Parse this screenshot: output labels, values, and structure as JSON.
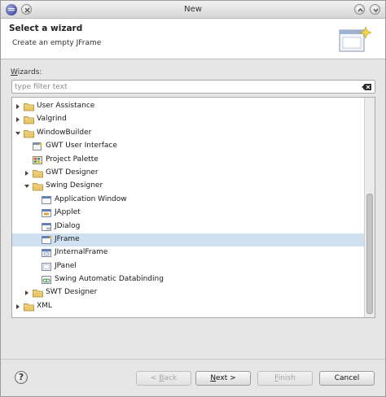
{
  "window": {
    "title": "New"
  },
  "header": {
    "title": "Select a wizard",
    "description": "Create an empty JFrame"
  },
  "wizards": {
    "label": "Wizards:",
    "filter_placeholder": "type filter text",
    "filter_value": ""
  },
  "tree": {
    "rows": [
      {
        "label": "User Assistance",
        "indent": 0,
        "state": "collapsed",
        "icon": "folder-icon",
        "selected": false
      },
      {
        "label": "Valgrind",
        "indent": 0,
        "state": "collapsed",
        "icon": "folder-icon",
        "selected": false
      },
      {
        "label": "WindowBuilder",
        "indent": 0,
        "state": "expanded",
        "icon": "folder-icon",
        "selected": false
      },
      {
        "label": "GWT User Interface",
        "indent": 1,
        "state": "leaf",
        "icon": "gwt-ui-icon",
        "selected": false
      },
      {
        "label": "Project Palette",
        "indent": 1,
        "state": "leaf",
        "icon": "palette-icon",
        "selected": false
      },
      {
        "label": "GWT Designer",
        "indent": 1,
        "state": "collapsed",
        "icon": "folder-icon",
        "selected": false
      },
      {
        "label": "Swing Designer",
        "indent": 1,
        "state": "expanded",
        "icon": "folder-icon",
        "selected": false
      },
      {
        "label": "Application Window",
        "indent": 2,
        "state": "leaf",
        "icon": "window-icon",
        "selected": false
      },
      {
        "label": "JApplet",
        "indent": 2,
        "state": "leaf",
        "icon": "applet-icon",
        "selected": false
      },
      {
        "label": "JDialog",
        "indent": 2,
        "state": "leaf",
        "icon": "dialog-icon",
        "selected": false
      },
      {
        "label": "JFrame",
        "indent": 2,
        "state": "leaf",
        "icon": "frame-icon",
        "selected": true
      },
      {
        "label": "JInternalFrame",
        "indent": 2,
        "state": "leaf",
        "icon": "internal-frame-icon",
        "selected": false
      },
      {
        "label": "JPanel",
        "indent": 2,
        "state": "leaf",
        "icon": "panel-icon",
        "selected": false
      },
      {
        "label": "Swing Automatic Databinding",
        "indent": 2,
        "state": "leaf",
        "icon": "databinding-icon",
        "selected": false
      },
      {
        "label": "SWT Designer",
        "indent": 1,
        "state": "collapsed",
        "icon": "folder-icon",
        "selected": false
      },
      {
        "label": "XML",
        "indent": 0,
        "state": "collapsed",
        "icon": "folder-icon",
        "selected": false
      }
    ]
  },
  "buttons": {
    "help_glyph": "?",
    "back_pre": "< ",
    "back_mn": "B",
    "back_rest": "ack",
    "next_mn": "N",
    "next_rest": "ext >",
    "finish_mn": "F",
    "finish_rest": "inish",
    "cancel": "Cancel"
  },
  "colors": {
    "selection": "#cfe0f1",
    "folder": "#e8c86a"
  }
}
